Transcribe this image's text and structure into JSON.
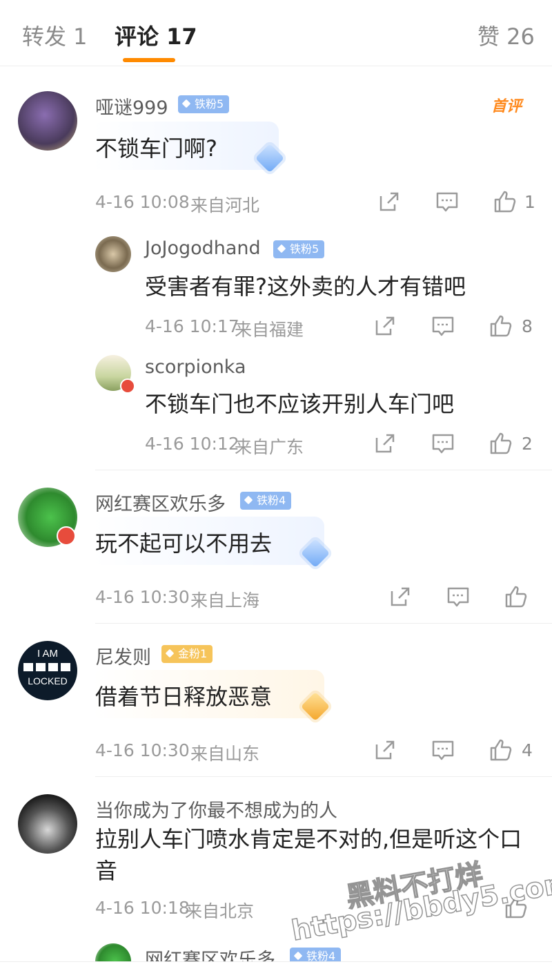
{
  "tabs": {
    "repost": "转发 1",
    "comments": "评论 17",
    "likes": "赞 26"
  },
  "top_tag": "首评",
  "comments": [
    {
      "user": "哑谜999",
      "badge": "铁粉5",
      "text": "不锁车门啊?",
      "time": "4-16 10:08",
      "location": "来自河北",
      "likes": "1"
    },
    {
      "user": "JoJogodhand",
      "badge": "铁粉5",
      "text": "受害者有罪?这外卖的人才有错吧",
      "time": "4-16 10:17",
      "location": "来自福建",
      "likes": "8"
    },
    {
      "user": "scorpionka",
      "text": "不锁车门也不应该开别人车门吧",
      "time": "4-16 10:12",
      "location": "来自广东",
      "likes": "2"
    },
    {
      "user": "网红赛区欢乐多",
      "badge": "铁粉4",
      "text": "玩不起可以不用去",
      "time": "4-16 10:30",
      "location": "来自上海"
    },
    {
      "user": "尼发则",
      "badge": "金粉1",
      "text": "借着节日释放恶意",
      "time": "4-16 10:30",
      "location": "来自山东",
      "likes": "4",
      "avatar_text": [
        "I AM",
        "LOCKED"
      ]
    },
    {
      "user": "当你成为了你最不想成为的人",
      "text": "拉别人车门喷水肯定是不对的,但是听这个口音",
      "time": "4-16 10:18",
      "location": "来自北京"
    },
    {
      "user": "网红赛区欢乐多",
      "badge": "铁粉4"
    }
  ],
  "watermark": {
    "line1": "黑料不打烊",
    "line2": "https://bbdy5.com"
  },
  "colors": {
    "accent": "#ff8a00",
    "iron_badge": "#8fb8f2",
    "gold_badge": "#f6c45a"
  }
}
